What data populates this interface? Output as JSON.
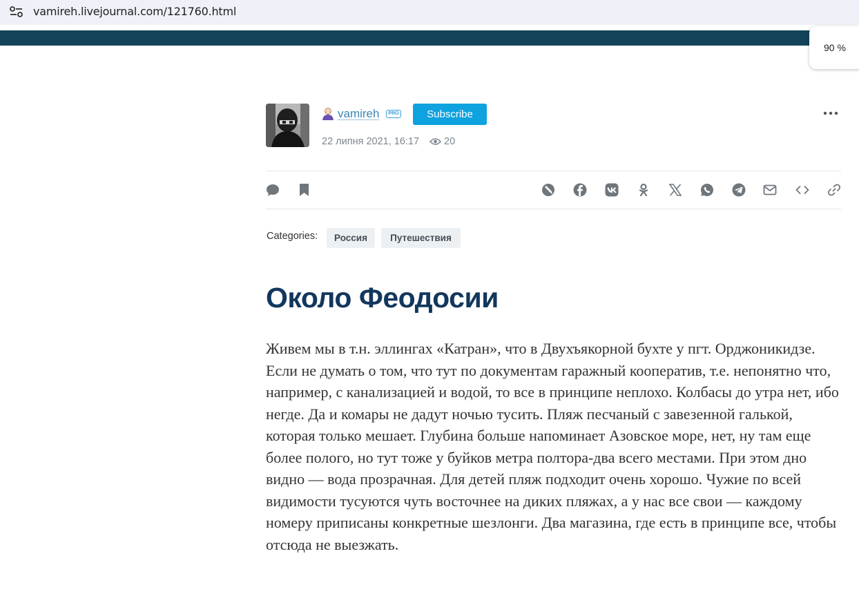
{
  "browser": {
    "url": "vamireh.livejournal.com/121760.html",
    "zoom": "90 %"
  },
  "author": {
    "username": "vamireh",
    "pro_badge": "PRO",
    "subscribe_label": "Subscribe",
    "date": "22 липня 2021, 16:17",
    "views": "20"
  },
  "actions": {
    "left": [
      "comment-icon",
      "bookmark-icon"
    ],
    "share": [
      "repost-icon",
      "facebook-icon",
      "vk-icon",
      "odnoklassniki-icon",
      "x-icon",
      "whatsapp-icon",
      "telegram-icon",
      "email-icon",
      "embed-icon",
      "link-icon"
    ]
  },
  "categories": {
    "label": "Categories:",
    "items": [
      "Россия",
      "Путешествия"
    ]
  },
  "post": {
    "title": "Около Феодосии",
    "body": "Живем мы в т.н. эллингах «Катран», что в Двухъякорной бухте у пгт. Орджоникидзе. Если не думать о том, что тут по документам гаражный кооператив, т.е. непонятно что, например, с канализацией и водой, то все в принципе неплохо. Колбасы до утра нет, ибо негде. Да и комары не дадут ночью тусить. Пляж песчаный с завезенной галькой, которая только мешает. Глубина больше напоминает Азовское море, нет, ну там еще более полого, но тут тоже у буйков метра полтора-два всего местами. При этом дно видно — вода прозрачная. Для детей пляж подходит очень хорошо. Чужие по всей видимости тусуются чуть восточнее на диких пляжах, а у нас все свои — каждому номеру приписаны конкретные шезлонги. Два магазина, где есть в принципе все, чтобы отсюда не выезжать."
  },
  "colors": {
    "lj_bar": "#134359",
    "subscribe": "#0ea2df",
    "title": "#12375e",
    "link": "#3a86b5"
  }
}
